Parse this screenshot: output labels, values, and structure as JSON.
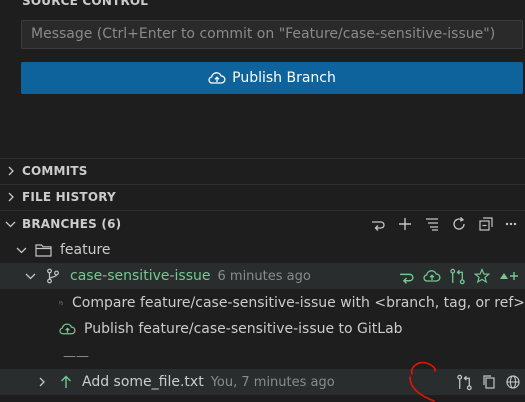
{
  "source_control": {
    "title": "SOURCE CONTROL",
    "message_placeholder": "Message (Ctrl+Enter to commit on \"Feature/case-sensitive-issue\")",
    "publish_label": "Publish Branch"
  },
  "sections": {
    "commits": "COMMITS",
    "file_history": "FILE HISTORY",
    "branches": "BRANCHES (6)"
  },
  "tree": {
    "folder": "feature",
    "branch_name": "case-sensitive-issue",
    "branch_time": "6 minutes ago",
    "compare_text": "Compare feature/case-sensitive-issue with <branch, tag, or ref>",
    "publish_text": "Publish feature/case-sensitive-issue to GitLab",
    "separator_text": "——",
    "commit_message": "Add some_file.txt",
    "commit_meta": "You, 7 minutes ago"
  },
  "colors": {
    "background": "#1e1e1e",
    "accent_button": "#0e639c",
    "branch_green": "#73c991",
    "annotation_red": "#e51400"
  },
  "icons": [
    "cloud-upload-icon",
    "chevron-right-icon",
    "chevron-down-icon",
    "switch-icon",
    "add-icon",
    "list-tree-icon",
    "refresh-icon",
    "collapse-all-icon",
    "more-icon",
    "folder-icon",
    "git-branch-icon",
    "compare-icon",
    "star-icon",
    "arrow-up-icon",
    "copy-icon",
    "globe-icon"
  ]
}
